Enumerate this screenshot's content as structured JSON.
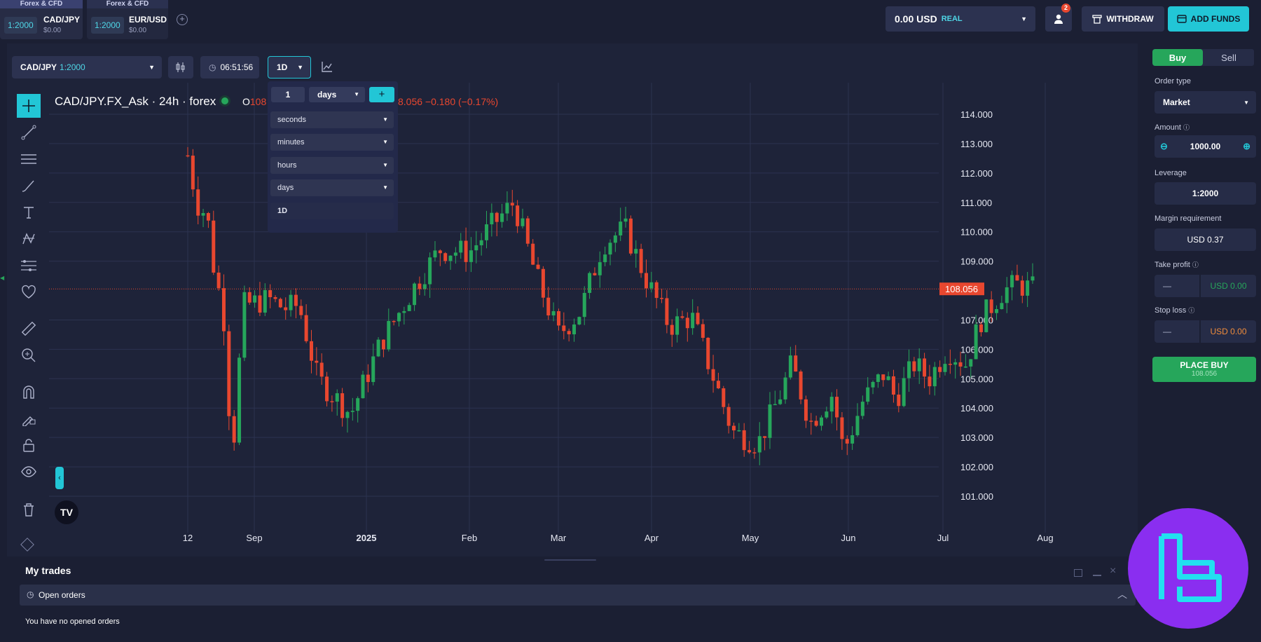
{
  "top_tabs": [
    {
      "tag": "Forex & CFD",
      "leverage": "1:2000",
      "symbol": "CAD/JPY",
      "value": "$0.00"
    },
    {
      "tag": "Forex & CFD",
      "leverage": "1:2000",
      "symbol": "EUR/USD",
      "value": "$0.00"
    }
  ],
  "account": {
    "balance": "0.00 USD",
    "mode": "REAL",
    "notifications": "2"
  },
  "buttons": {
    "withdraw": "WITHDRAW",
    "add_funds": "ADD FUNDS"
  },
  "chart_toolbar": {
    "symbol": "CAD/JPY",
    "leverage": "1:2000",
    "timer": "06:51:56",
    "interval": "1D"
  },
  "chart_header": {
    "title": "CAD/JPY.FX_Ask · 24h · forex",
    "open_prefix": "O",
    "open_value": "108",
    "change": "8.056 −0.180 (−0.17%)"
  },
  "interval_dropdown": {
    "count": "1",
    "unit": "days",
    "options": [
      "seconds",
      "minutes",
      "hours",
      "days"
    ],
    "selected": "1D"
  },
  "chart_data": {
    "type": "candlestick",
    "title": "CAD/JPY.FX_Ask · 24h · forex",
    "x_tick_labels": [
      "12",
      "Sep",
      "2025",
      "Feb",
      "Mar",
      "Apr",
      "May",
      "Jun",
      "Jul",
      "Aug"
    ],
    "y_tick_labels": [
      "114.000",
      "113.000",
      "112.000",
      "111.000",
      "110.000",
      "109.000",
      "107.000",
      "106.000",
      "105.000",
      "104.000",
      "103.000",
      "102.000",
      "101.000"
    ],
    "ylim": [
      100.5,
      114.5
    ],
    "last_price": "108.056",
    "last_price_value": 108.056,
    "grid": true,
    "colors": {
      "up": "#26a65b",
      "down": "#e8472f",
      "grid": "#2c3350",
      "last": "#e8472f"
    },
    "seed": 7,
    "path_anchors": [
      [
        0.0,
        112.6
      ],
      [
        0.012,
        111.0
      ],
      [
        0.02,
        110.7
      ],
      [
        0.025,
        110.8
      ],
      [
        0.035,
        108.8
      ],
      [
        0.048,
        107.3
      ],
      [
        0.06,
        102.2
      ],
      [
        0.075,
        107.5
      ],
      [
        0.11,
        107.7
      ],
      [
        0.13,
        107.4
      ],
      [
        0.15,
        107.5
      ],
      [
        0.175,
        105.0
      ],
      [
        0.22,
        103.8
      ],
      [
        0.26,
        106.2
      ],
      [
        0.31,
        108.3
      ],
      [
        0.34,
        109.4
      ],
      [
        0.38,
        109.3
      ],
      [
        0.41,
        110.2
      ],
      [
        0.44,
        111.0
      ],
      [
        0.47,
        108.5
      ],
      [
        0.5,
        106.5
      ],
      [
        0.53,
        107.3
      ],
      [
        0.56,
        109.6
      ],
      [
        0.59,
        110.1
      ],
      [
        0.62,
        108.3
      ],
      [
        0.65,
        106.8
      ],
      [
        0.68,
        107.1
      ],
      [
        0.71,
        105.0
      ],
      [
        0.735,
        103.2
      ],
      [
        0.77,
        102.8
      ],
      [
        0.8,
        104.5
      ],
      [
        0.815,
        105.5
      ],
      [
        0.84,
        103.5
      ],
      [
        0.87,
        104.5
      ],
      [
        0.885,
        102.5
      ],
      [
        0.91,
        104.2
      ],
      [
        0.94,
        105.2
      ],
      [
        0.955,
        104.3
      ],
      [
        0.98,
        105.5
      ],
      [
        1.0,
        105.0
      ],
      [
        1.025,
        106.0
      ],
      [
        1.05,
        105.5
      ],
      [
        1.07,
        107.0
      ],
      [
        1.1,
        108.0
      ],
      [
        1.12,
        108.2
      ],
      [
        1.14,
        108.06
      ]
    ]
  },
  "sidebar_icons": [
    "crosshair-icon",
    "trend-line-icon",
    "fib-icon",
    "brush-icon",
    "text-icon",
    "pattern-icon",
    "forecast-icon",
    "heart-icon",
    "ruler-icon",
    "zoom-in-icon",
    "magnet-icon",
    "lock-draw-icon",
    "lock-icon",
    "eye-icon",
    "trash-icon"
  ],
  "order_panel": {
    "buy": "Buy",
    "sell": "Sell",
    "order_type_label": "Order type",
    "order_type": "Market",
    "amount_label": "Amount",
    "amount": "1000.00",
    "leverage_label": "Leverage",
    "leverage": "1:2000",
    "margin_label": "Margin requirement",
    "margin": "USD 0.37",
    "take_profit_label": "Take profit",
    "take_profit_value": "USD 0.00",
    "take_profit_dash": "—",
    "stop_loss_label": "Stop loss",
    "stop_loss_value": "USD 0.00",
    "stop_loss_dash": "—",
    "place_buy": "PLACE BUY",
    "place_buy_price": "108.056"
  },
  "trades": {
    "title": "My trades",
    "open_orders": "Open orders",
    "empty": "You have no opened orders"
  }
}
